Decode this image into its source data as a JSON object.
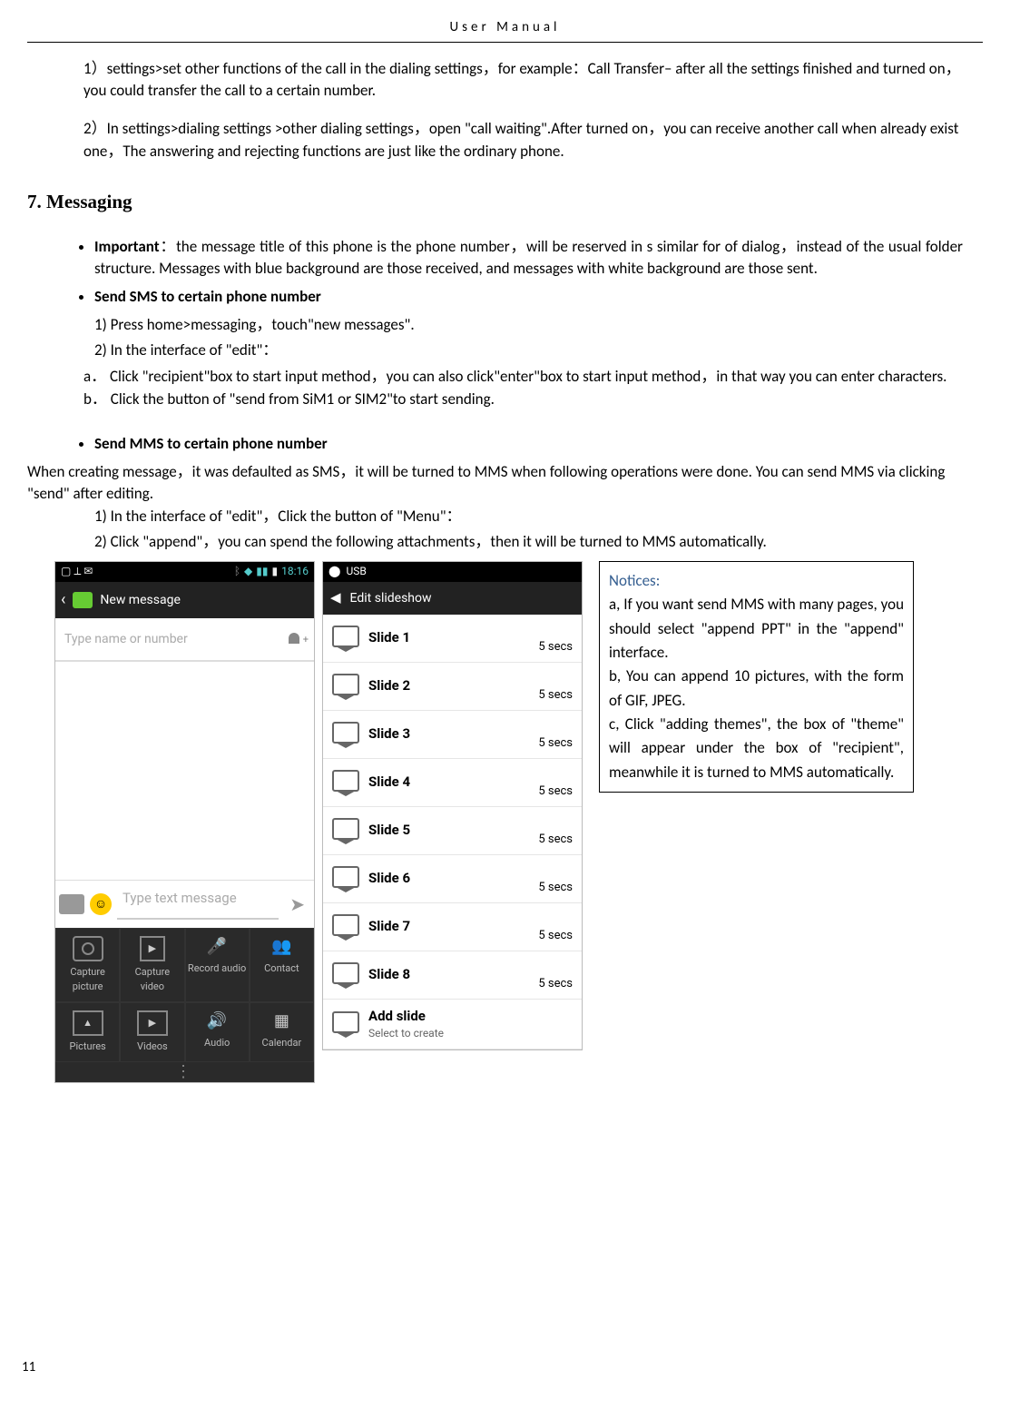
{
  "header": {
    "title": "User    Manual"
  },
  "para1": "  1）settings>set other functions of the call in the dialing settings，for example：Call Transfer– after all the settings finished and turned on，you could transfer the call to a certain number.",
  "para2": "  2）In settings>dialing settings >other dialing settings，open \"call waiting\".After turned on，you can receive another call when already exist one，The answering and rejecting functions are just like the ordinary phone.",
  "section7": "7. Messaging",
  "important_label": "Important",
  "important_text": "：the message title of this phone is the phone number，will be reserved in s similar for of dialog，instead of the usual folder structure. Messages with blue background are those received, and messages with white background are those sent.",
  "send_sms_label": "Send SMS to certain phone number",
  "sms_1": "1)    Press home>messaging，touch\"new messages\".",
  "sms_2": "2)    In the interface of \"edit\"：",
  "sms_a": "a．   Click \"recipient\"box to start input method，you can also click\"enter\"box to start input method，in that way you can enter characters.",
  "sms_b": "b．   Click the button of  \"send from SiM1 or SIM2\"to start sending.",
  "send_mms_label": "Send MMS to certain phone number",
  "mms_intro": "    When creating message，it was defaulted as SMS，it will be turned to MMS when following operations were done. You can send MMS via clicking \"send\" after editing.",
  "mms_1": "1)    In the interface of \"edit\"，Click the button of \"Menu\"：",
  "mms_2": "2)    Click  \"append\"，you can spend the following attachments，then it will be turned to MMS automatically.",
  "phone1": {
    "status_time": "18:16",
    "app_title": "New message",
    "recipient_placeholder": "Type name or number",
    "text_placeholder": "Type text message",
    "attach": {
      "r1c1": "Capture picture",
      "r1c2": "Capture video",
      "r1c3": "Record audio",
      "r1c4": "Contact",
      "r2c1": "Pictures",
      "r2c2": "Videos",
      "r2c3": "Audio",
      "r2c4": "Calendar"
    },
    "navdots": "⋮"
  },
  "phone2": {
    "usb_label": "USB",
    "edit_title": "Edit slideshow",
    "slides": [
      {
        "label": "Slide 1",
        "dur": "5 secs"
      },
      {
        "label": "Slide 2",
        "dur": "5 secs"
      },
      {
        "label": "Slide 3",
        "dur": "5 secs"
      },
      {
        "label": "Slide 4",
        "dur": "5 secs"
      },
      {
        "label": "Slide 5",
        "dur": "5 secs"
      },
      {
        "label": "Slide 6",
        "dur": "5 secs"
      },
      {
        "label": "Slide 7",
        "dur": "5 secs"
      },
      {
        "label": "Slide 8",
        "dur": "5 secs"
      }
    ],
    "add_label": "Add slide",
    "add_sub": "Select to create"
  },
  "notices": {
    "title": "Notices:",
    "a": "a, If you want send MMS with many pages, you should select \"append PPT\" in the \"append\" interface.",
    "b": "b, You can append 10 pictures, with the form of GIF, JPEG.",
    "c": "c, Click \"adding themes\", the box of \"theme\" will appear under the box of \"recipient\", meanwhile it is turned to MMS automatically."
  },
  "pagenum": "11"
}
